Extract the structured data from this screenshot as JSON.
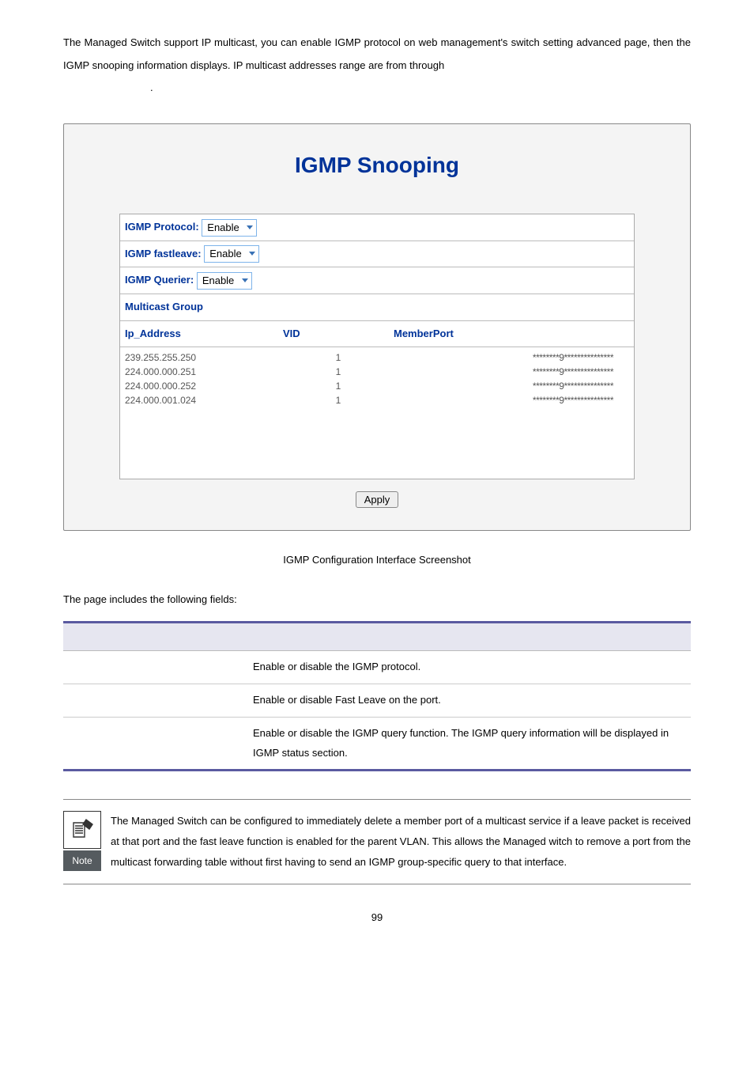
{
  "intro": "The Managed Switch support IP multicast, you can enable IGMP protocol on web management's switch setting advanced page, then the IGMP snooping information displays. IP multicast addresses range are from              through",
  "intro_tail": ".",
  "screenshot": {
    "title": "IGMP Snooping",
    "rows": [
      {
        "label": "IGMP Protocol:",
        "value": "Enable"
      },
      {
        "label": "IGMP fastleave:",
        "value": "Enable"
      },
      {
        "label": "IGMP Querier:",
        "value": "Enable"
      }
    ],
    "multicast_label": "Multicast Group",
    "grid": {
      "headers": {
        "col1": "Ip_Address",
        "col2": "VID",
        "col3": "MemberPort"
      },
      "rows": [
        {
          "ip": "239.255.255.250",
          "vid": "1",
          "port": "********9***************"
        },
        {
          "ip": "224.000.000.251",
          "vid": "1",
          "port": "********9***************"
        },
        {
          "ip": "224.000.000.252",
          "vid": "1",
          "port": "********9***************"
        },
        {
          "ip": "224.000.001.024",
          "vid": "1",
          "port": "********9***************"
        }
      ]
    },
    "apply": "Apply"
  },
  "caption": "IGMP Configuration Interface Screenshot",
  "section_lead": "The page includes the following fields:",
  "fields_table": {
    "rows": [
      {
        "desc": "Enable or disable the IGMP protocol."
      },
      {
        "desc": "Enable or disable Fast Leave on the port."
      },
      {
        "desc": "Enable or disable the IGMP query function. The IGMP query information will be displayed in IGMP status section."
      }
    ]
  },
  "note": {
    "label": "Note",
    "text": "The Managed Switch can be configured to immediately delete a member port of a multicast service if a leave packet is received at that port and the fast leave function is enabled for the parent VLAN. This allows the Managed witch to remove a port from the multicast forwarding table without first having to send an IGMP group-specific query to that interface."
  },
  "page_number": "99"
}
